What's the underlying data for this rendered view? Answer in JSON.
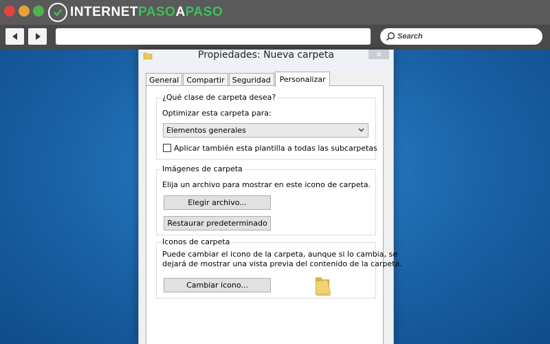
{
  "chrome": {
    "logo": {
      "part1": "INTERNET",
      "part2": "PASO",
      "part3": "A",
      "part4": "PASO"
    },
    "search_placeholder": "Search",
    "colors": {
      "red": "#e0443e",
      "yellow": "#e9a23b",
      "green": "#4fb34a",
      "logo_accent": "#3fbf5a"
    }
  },
  "dialog": {
    "title": "Propiedades: Nueva carpeta",
    "close_icon": "close-icon",
    "tabs": [
      {
        "label": "General"
      },
      {
        "label": "Compartir"
      },
      {
        "label": "Seguridad"
      },
      {
        "label": "Personalizar"
      }
    ],
    "active_tab": "Personalizar",
    "folder_type": {
      "legend": "¿Qué clase de carpeta desea?",
      "optimize_label": "Optimizar esta carpeta para:",
      "selected": "Elementos generales",
      "checkbox_label": "Aplicar también esta plantilla a todas las subcarpetas",
      "checkbox_checked": false
    },
    "folder_images": {
      "legend": "Imágenes de carpeta",
      "description": "Elija un archivo para mostrar en este icono de carpeta.",
      "choose_button": "Elegir archivo...",
      "restore_button": "Restaurar predeterminado"
    },
    "folder_icons": {
      "legend": "Iconos de carpeta",
      "description_line1": "Puede cambiar el icono de la carpeta, aunque si lo cambia, se",
      "description_line2": "dejará de mostrar una vista previa del contenido de la carpeta.",
      "change_button": "Cambiar icono..."
    }
  }
}
